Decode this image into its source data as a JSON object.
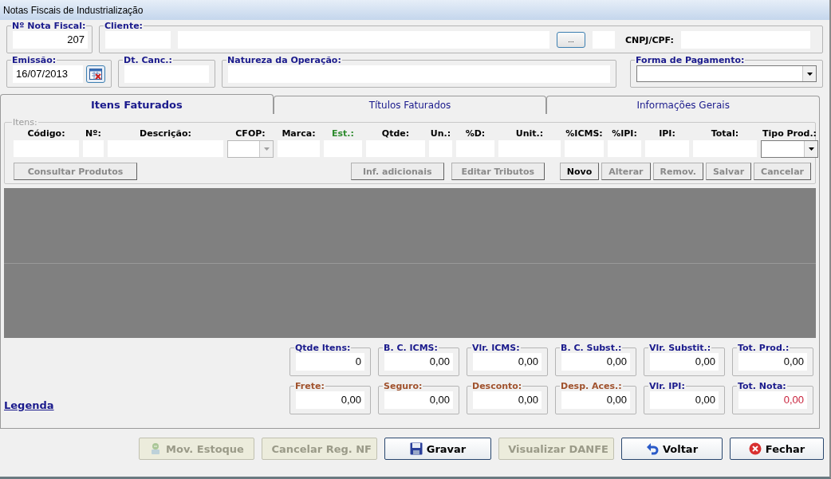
{
  "window": {
    "title": "Notas Fiscais de Industrialização"
  },
  "header": {
    "nota_fiscal": {
      "label": "Nº Nota Fiscal:",
      "value": "207"
    },
    "cliente": {
      "label": "Cliente:",
      "lookup_button": "...",
      "cnpj_label": "CNPJ/CPF:"
    },
    "emissao": {
      "label": "Emissão:",
      "value": "16/07/2013"
    },
    "dt_canc": {
      "label": "Dt. Canc.:"
    },
    "natureza": {
      "label": "Natureza da Operação:"
    },
    "forma_pagamento": {
      "label": "Forma de Pagamento:"
    }
  },
  "tabs": [
    {
      "label": "Itens Faturados",
      "selected": true
    },
    {
      "label": "Títulos Faturados",
      "selected": false
    },
    {
      "label": "Informações Gerais",
      "selected": false
    }
  ],
  "itens": {
    "label": "Itens:",
    "columns": [
      {
        "label": "Código:",
        "kind": "text",
        "color": "#000000"
      },
      {
        "label": "Nº:",
        "kind": "text",
        "color": "#000000"
      },
      {
        "label": "Descrição:",
        "kind": "text",
        "color": "#000000"
      },
      {
        "label": "CFOP:",
        "kind": "select",
        "disabled": true,
        "color": "#000000"
      },
      {
        "label": "Marca:",
        "kind": "text",
        "color": "#000000"
      },
      {
        "label": "Est.:",
        "kind": "text",
        "color": "#2e8b2e"
      },
      {
        "label": "Qtde:",
        "kind": "text",
        "color": "#000000"
      },
      {
        "label": "Un.:",
        "kind": "text",
        "color": "#000000"
      },
      {
        "label": "%D:",
        "kind": "text",
        "color": "#000000"
      },
      {
        "label": "Unit.:",
        "kind": "text",
        "color": "#000000"
      },
      {
        "label": "%ICMS:",
        "kind": "text",
        "color": "#000000"
      },
      {
        "label": "%IPI:",
        "kind": "text",
        "color": "#000000"
      },
      {
        "label": "IPI:",
        "kind": "text",
        "color": "#000000"
      },
      {
        "label": "Total:",
        "kind": "text",
        "color": "#000000"
      },
      {
        "label": "Tipo Prod.:",
        "kind": "select",
        "disabled": false,
        "color": "#000000"
      }
    ],
    "tool_buttons": [
      {
        "label": "Consultar Produtos",
        "disabled": true
      }
    ],
    "edit_buttons": [
      {
        "label": "Inf. adicionais",
        "disabled": true
      },
      {
        "label": "Editar Tributos",
        "disabled": true
      }
    ],
    "actions": [
      {
        "label": "Novo",
        "disabled": false
      },
      {
        "label": "Alterar",
        "disabled": true
      },
      {
        "label": "Remov.",
        "disabled": true
      },
      {
        "label": "Salvar",
        "disabled": true
      },
      {
        "label": "Cancelar",
        "disabled": true
      }
    ]
  },
  "totals": [
    {
      "label": "Qtde Itens:",
      "value": "0",
      "color": "#1a1a8c",
      "kind": "plain"
    },
    {
      "label": "B. C. ICMS:",
      "value": "0,00",
      "color": "#1a1a8c",
      "kind": "plain"
    },
    {
      "label": "Vlr. ICMS:",
      "value": "0,00",
      "color": "#1a1a8c",
      "kind": "plain"
    },
    {
      "label": "B. C. Subst.:",
      "value": "0,00",
      "color": "#1a1a8c",
      "kind": "plain"
    },
    {
      "label": "Vlr. Substit.:",
      "value": "0,00",
      "color": "#1a1a8c",
      "kind": "plain"
    },
    {
      "label": "Tot. Prod.:",
      "value": "0,00",
      "color": "#1a1a8c",
      "kind": "plain"
    },
    {
      "label": "Frete:",
      "value": "0,00",
      "color": "#a0522d",
      "kind": "plain"
    },
    {
      "label": "Seguro:",
      "value": "0,00",
      "color": "#a0522d",
      "kind": "plain"
    },
    {
      "label": "Desconto:",
      "value": "0,00",
      "color": "#a0522d",
      "kind": "plain"
    },
    {
      "label": "Desp. Aces.:",
      "value": "0,00",
      "color": "#a0522d",
      "kind": "plain"
    },
    {
      "label": "Vlr. IPI:",
      "value": "0,00",
      "color": "#1a1a8c",
      "kind": "plain"
    },
    {
      "label": "Tot. Nota:",
      "value": "0,00",
      "color": "#1a1a8c",
      "kind": "grand_total"
    }
  ],
  "legend_link": "Legenda",
  "footer_buttons": [
    {
      "label": "Mov. Estoque",
      "kind": "stock",
      "disabled": true
    },
    {
      "label": "Cancelar Reg. NF",
      "kind": "grid",
      "disabled": true
    },
    {
      "label": "Gravar",
      "kind": "save",
      "disabled": false
    },
    {
      "label": "Visualizar DANFE",
      "kind": "document",
      "disabled": true
    },
    {
      "label": "Voltar",
      "kind": "undo",
      "disabled": false
    },
    {
      "label": "Fechar",
      "kind": "close",
      "disabled": false
    }
  ]
}
